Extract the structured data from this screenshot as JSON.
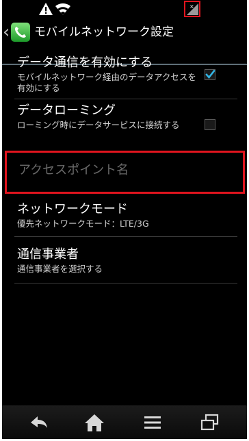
{
  "status_bar": {
    "icons": [
      "warning-icon",
      "wifi-icon",
      "no-signal-icon"
    ]
  },
  "header": {
    "title": "モバイルネットワーク設定",
    "back_glyph": "‹",
    "app_icon": "phone-icon"
  },
  "settings": {
    "data_enabled": {
      "title": "データ通信を有効にする",
      "summary": "モバイルネットワーク経由のデータアクセスを有効にする",
      "checked": true
    },
    "data_roaming": {
      "title": "データローミング",
      "summary": "ローミング時にデータサービスに接続する",
      "checked": false
    },
    "apn": {
      "title": "アクセスポイント名",
      "enabled": false
    },
    "network_mode": {
      "title": "ネットワークモード",
      "summary": "優先ネットワークモード：LTE/3G"
    },
    "operator": {
      "title": "通信事業者",
      "summary": "通信事業者を選択する"
    }
  },
  "nav_bar": {
    "buttons": [
      "back-icon",
      "home-icon",
      "menu-icon",
      "recent-apps-icon"
    ]
  },
  "colors": {
    "background": "#000000",
    "highlight_box": "#e0141e",
    "checkbox_tick": "#33b5e5",
    "divider": "#5f6f78"
  }
}
